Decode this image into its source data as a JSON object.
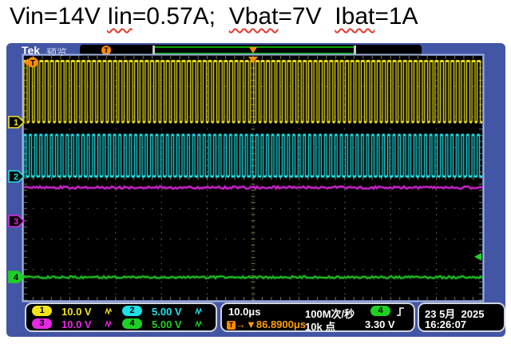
{
  "title": {
    "parts": [
      {
        "text": "Vin=14V ",
        "wavy": false
      },
      {
        "text": "Iin",
        "wavy": true
      },
      {
        "text": "=0.57A;  ",
        "wavy": false
      },
      {
        "text": "Vbat",
        "wavy": true
      },
      {
        "text": "=7V  ",
        "wavy": false
      },
      {
        "text": "Ibat",
        "wavy": true
      },
      {
        "text": "=1A",
        "wavy": false
      }
    ]
  },
  "scope": {
    "brand": "Tek",
    "status_label": "预览",
    "record_bar": {
      "trigger_marker": "T"
    },
    "channel_markers": [
      {
        "num": "1",
        "color_key": "ch1"
      },
      {
        "num": "2",
        "color_key": "ch2"
      },
      {
        "num": "3",
        "color_key": "ch3"
      },
      {
        "num": "4",
        "color_key": "ch4"
      }
    ],
    "readout_channels": [
      {
        "num": "1",
        "scale": "10.0 V",
        "color_key": "ch1"
      },
      {
        "num": "2",
        "scale": "5.00 V",
        "color_key": "ch2"
      },
      {
        "num": "3",
        "scale": "10.0 V",
        "color_key": "ch3"
      },
      {
        "num": "4",
        "scale": "5.00 V",
        "color_key": "ch4"
      }
    ],
    "horizontal": {
      "timebase": "10.0μs",
      "sample_rate": "100M次/秒",
      "trigger_pos_prefix": "→▼",
      "trigger_pos": "86.8900μs",
      "record_length": "10k 点"
    },
    "trigger": {
      "source_num": "4",
      "level": "3.30 V",
      "slope_icon": "rising-edge"
    },
    "datetime": {
      "date": "23 5月  2025",
      "time": "16:26:07"
    }
  },
  "colors": {
    "ch1": "#f2e418",
    "ch2": "#1ce2e8",
    "ch3": "#e428e4",
    "ch4": "#1fd024",
    "bezel": "#4355a5",
    "plot_border": "#9fb2da",
    "graticule": "#85855c",
    "trigger_orange": "#ff8c00",
    "record_green": "#00a400"
  },
  "chart_data": {
    "type": "line",
    "title": "Oscilloscope capture: DC-DC converter switching waveforms",
    "x_axis": {
      "per_div": "10.0μs",
      "divisions": 10,
      "total_span_us": 100
    },
    "y_axis": {
      "divisions": 8
    },
    "legend_position": "bottom readout bar",
    "grid": true,
    "series": [
      {
        "name": "CH1",
        "color_key": "ch1",
        "volts_per_div": 10.0,
        "waveform": "square",
        "period_us": 1.15,
        "duty_high": 0.6,
        "high_v": 20.0,
        "low_v": 0.0,
        "description": "dense ~0-20V square wave, top quarter of screen"
      },
      {
        "name": "CH2",
        "color_key": "ch2",
        "volts_per_div": 5.0,
        "waveform": "square",
        "period_us": 1.15,
        "duty_high": 0.42,
        "high_v": 6.8,
        "low_v": 0.0,
        "description": "dense ~0-7V square wave, above center line"
      },
      {
        "name": "CH3",
        "color_key": "ch3",
        "volts_per_div": 10.0,
        "waveform": "dc",
        "level_v": 11.0,
        "noise_vpp": 0.8,
        "description": "flat noisy DC line just below center"
      },
      {
        "name": "CH4",
        "color_key": "ch4",
        "volts_per_div": 5.0,
        "waveform": "dc",
        "level_v": -0.05,
        "noise_vpp": 0.35,
        "description": "flat noisy DC line near bottom of screen"
      }
    ],
    "trigger": {
      "source": "CH4",
      "level_v": 3.3,
      "slope": "rising"
    }
  }
}
